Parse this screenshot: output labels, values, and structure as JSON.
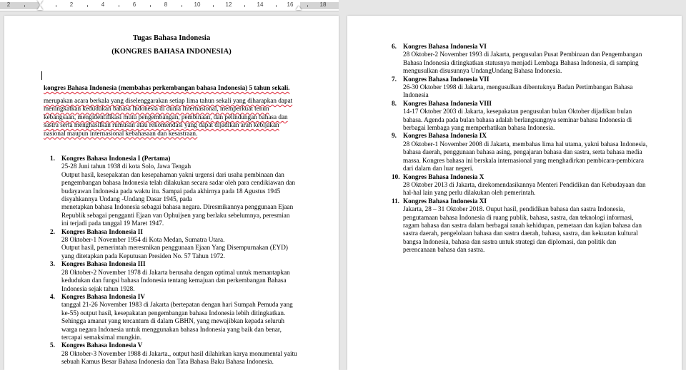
{
  "ruler": {
    "numbers": [
      "2",
      "2",
      "4",
      "6",
      "8",
      "10",
      "12",
      "14",
      "16",
      "18"
    ]
  },
  "page1": {
    "title": "Tugas Bahasa Indonesia",
    "subtitle": "(KONGRES BAHASA INDONESIA)",
    "intro": "kongres Bahasa Indonesia (membahas perkembangan bahasa Indonesia)  5 tahun sekali.",
    "body": "merupakan acara berkala yang diselenggarakan setiap lima tahun sekali yang diharapkan dapat meningkatkan kedudukan bahasa Indonesia di dunia Internasional, memperkuat tenun kebangsaan, mengidentifikasi mutu pengembangan, pembinaan, dan pelindungan bahasa dan sastra serta menghasilkan rumusan atau rekomendasi yang dapat dijadikan arah kebijakan nasional maupun internasional kebahasaan dan kesastraan.",
    "items": [
      {
        "num": "1.",
        "title": "Kongres Bahasa Indonesia I (Pertama)",
        "text": "25-28 Juni tahun 1938 di kota Solo, Jawa Tengah\nOutput hasil, kesepakatan dan kesepahaman yakni urgensi dari usaha pembinaan dan pengembangan bahasa Indonesia telah dilakukan secara sadar oleh para cendikiawan dan budayawan Indonesia pada waktu itu. Sampai pada akhirnya pada 18 Agustus 1945 disyahkannya Undang -Undang Dasar 1945, pada\nmenetapkan bahasa Indonesia sebagai bahasa negara. Diresmikannya penggunaan Ejaan Republik sebagai pengganti Ejaan van Ophuijsen yang berlaku sebelumnya, peresmian ini terjadi pada tanggal 19 Maret 1947."
      },
      {
        "num": "2.",
        "title": "Kongres Bahasa Indonesia II",
        "text": "28 Oktober-1 November 1954 di Kota Medan, Sumatra Utara.\nOutput hasil, pemerintah meresmikan penggunaan Ejaan Yang Disempurnakan (EYD) yang ditetapkan pada Keputusan Presiden No. 57 Tahun 1972."
      },
      {
        "num": "3.",
        "title": "Kongres Bahasa Indonesia III",
        "text": "28 Oktober-2 November 1978 di Jakarta berusaha dengan optimal untuk memantapkan kedudukan dan fungsi bahasa Indonesia tentang kemajuan dan perkembangan Bahasa Indonesia sejak tahun 1928."
      },
      {
        "num": "4.",
        "title": "Kongres Bahasa Indonesia IV",
        "text": "tanggal 21-26 November 1983 di Jakarta (bertepatan dengan hari Sumpah Pemuda yang ke-55) output hasil, kesepakatan pengembangan bahasa Indonesia lebih ditingkatkan. Sehingga amanat yang tercantum di dalam GBHN, yang mewajibkan kepada seluruh warga negara Indonesia untuk menggunakan bahasa Indonesia yang baik dan benar, tercapai semaksimal mungkin."
      },
      {
        "num": "5.",
        "title": "Kongres Bahasa Indonesia V",
        "text": "28 Oktober-3 November 1988 di Jakarta., output hasil dilahirkan karya monumental yaitu sebuah Kamus Besar Bahasa Indonesia dan Tata Bahasa Baku Bahasa Indonesia."
      }
    ]
  },
  "page2": {
    "items": [
      {
        "num": "6.",
        "title": "Kongres Bahasa Indonesia VI",
        "text": "28 Oktober-2 November 1993 di Jakarta, pengusulan Pusat Pembinaan dan Pengembangan Bahasa Indonesia ditingkatkan statusnya menjadi Lembaga Bahasa Indonesia, di samping mengusulkan disusunnya UndangUndang Bahasa Indonesia."
      },
      {
        "num": "7.",
        "title": "Kongres Bahasa Indonesia VII",
        "text": "26-30 Oktober 1998 di Jakarta, mengusulkan dibentuknya Badan Pertimbangan Bahasa Indonesia"
      },
      {
        "num": "8.",
        "title": "Kongres Bahasa Indonesia VIII",
        "text": "14-17 Oktober 2003 di Jakarta, kesepakatan pengusulan bulan Oktober dijadikan bulan bahasa.  Agenda pada bulan bahasa adalah berlangsungnya seminar bahasa Indonesia di berbagai lembaga yang memperhatikan bahasa Indonesia."
      },
      {
        "num": "9.",
        "title": "Kongres Bahasa Indonesia IX",
        "text": "28 Oktober-1 November 2008 di Jakarta, membahas lima hal utama, yakni bahasa Indonesia, bahasa daerah, penggunaan bahasa asing, pengajaran bahasa dan sastra, serta bahasa media massa. Kongres bahasa ini berskala internasional yang menghadirkan pembicara-pembicara dari dalam dan luar negeri."
      },
      {
        "num": "10.",
        "title": "Kongres Bahasa Indonesia X",
        "text": "28 Oktober 2013 di Jakarta, direkomendasikannya Menteri Pendidikan dan Kebudayaan dan hal-hal lain yang perlu dilakukan oleh pemerintah."
      },
      {
        "num": "11.",
        "title": "Kongres Bahasa Indonesia XI",
        "text": "Jakarta, 28 – 31 Oktober 2018. Ouput hasil, pendidikan bahasa dan sastra Indonesia, pengutamaan bahasa Indonesia di ruang publik, bahasa, sastra, dan teknologi informasi, ragam bahasa dan sastra dalam berbagai ranah kehidupan, pemetaan dan kajian bahasa dan sastra daerah, pengelolaan bahasa dan sastra daerah, bahasa, sastra, dan kekuatan kultural bangsa Indonesia, bahasa dan sastra untuk strategi dan diplomasi, dan politik dan perencanaan bahasa dan sastra."
      }
    ]
  }
}
